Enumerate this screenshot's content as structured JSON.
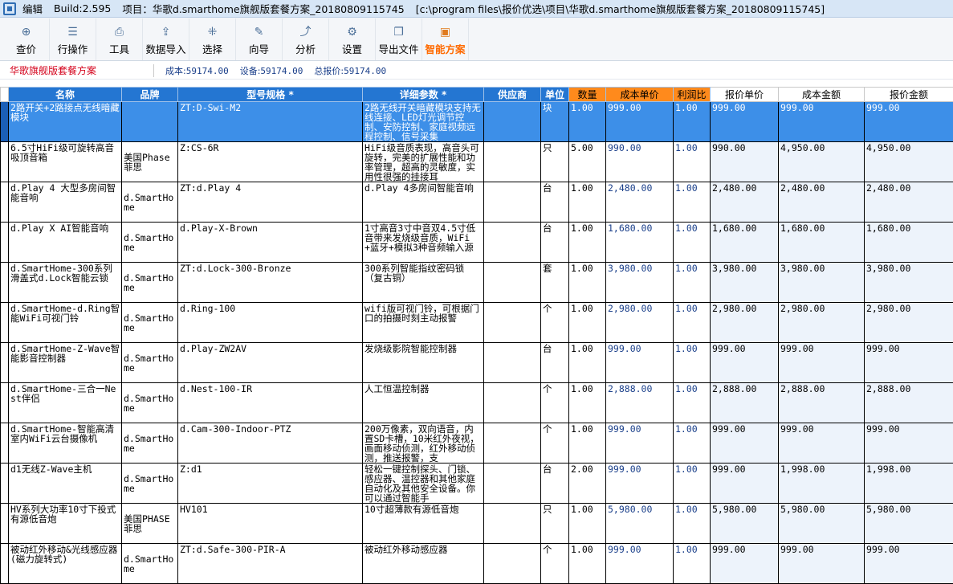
{
  "titlebar": {
    "menu_edit": "编辑",
    "build": "Build:2.595",
    "project": "项目：华歌d.smarthome旗舰版套餐方案_20180809115745",
    "path": "[c:\\program files\\报价优选\\项目\\华歌d.smarthome旗舰版套餐方案_20180809115745]"
  },
  "toolbar": {
    "items": [
      {
        "label": "查价",
        "icon": "⊕"
      },
      {
        "label": "行操作",
        "icon": "☰"
      },
      {
        "label": "工具",
        "icon": "⎙"
      },
      {
        "label": "数据导入",
        "icon": "⇪"
      },
      {
        "label": "选择",
        "icon": "⁜"
      },
      {
        "label": "向导",
        "icon": "✎"
      },
      {
        "label": "分析",
        "icon": "⤴"
      },
      {
        "label": "设置",
        "icon": "⚙"
      },
      {
        "label": "导出文件",
        "icon": "❐"
      },
      {
        "label": "智能方案",
        "icon": "▣"
      }
    ]
  },
  "info": {
    "scheme_name": "华歌旗舰版套餐方案",
    "cost_label": "成本:",
    "cost_value": "59174.00",
    "device_label": "设备:",
    "device_value": "59174.00",
    "total_label": "总报价:",
    "total_value": "59174.00"
  },
  "table": {
    "headers": [
      "名称",
      "品牌",
      "型号规格 *",
      "详细参数 *",
      "供应商",
      "单位",
      "数量",
      "成本单价",
      "利润比",
      "报价单价",
      "成本金额",
      "报价金额"
    ],
    "rows": [
      [
        "2路开关+2路接点无线暗藏模块",
        "",
        "ZT:D-Swi-M2",
        "2路无线开关暗藏模块支持无线连接、LED灯光调节控制、安防控制、家庭视频远程控制、信号采集",
        "",
        "块",
        "1.00",
        "999.00",
        "1.00",
        "999.00",
        "999.00",
        "999.00"
      ],
      [
        "6.5寸HiFi级可旋转高音吸顶音箱",
        "美国Phase菲思",
        "Z:CS-6R",
        "HiFi级音质表现，高音头可旋转，完美的扩展性能和功率管理，超高的灵敏度，实用性很强的挂接耳",
        "",
        "只",
        "5.00",
        "990.00",
        "1.00",
        "990.00",
        "4,950.00",
        "4,950.00"
      ],
      [
        "d.Play 4 大型多房间智能音响",
        "d.SmartHome",
        "ZT:d.Play 4",
        "d.Play 4多房间智能音响",
        "",
        "台",
        "1.00",
        "2,480.00",
        "1.00",
        "2,480.00",
        "2,480.00",
        "2,480.00"
      ],
      [
        "d.Play X AI智能音响",
        "d.SmartHome",
        "d.Play-X-Brown",
        "1寸高音3寸中音双4.5寸低音带来发烧级音质，WiFi+蓝牙+模拟3种音频输入源",
        "",
        "台",
        "1.00",
        "1,680.00",
        "1.00",
        "1,680.00",
        "1,680.00",
        "1,680.00"
      ],
      [
        "d.SmartHome-300系列滑盖式d.Lock智能云锁",
        "d.SmartHome",
        "ZT:d.Lock-300-Bronze",
        "300系列智能指纹密码锁（复古铜）",
        "",
        "套",
        "1.00",
        "3,980.00",
        "1.00",
        "3,980.00",
        "3,980.00",
        "3,980.00"
      ],
      [
        "d.SmartHome-d.Ring智能WiFi可视门铃",
        "d.SmartHome",
        "d.Ring-100",
        "wifi版可视门铃，可根据门口的拍摄时刻主动报警",
        "",
        "个",
        "1.00",
        "2,980.00",
        "1.00",
        "2,980.00",
        "2,980.00",
        "2,980.00"
      ],
      [
        "d.SmartHome-Z-Wave智能影音控制器",
        "d.SmartHome",
        "d.Play-ZW2AV",
        "发烧级影院智能控制器",
        "",
        "台",
        "1.00",
        "999.00",
        "1.00",
        "999.00",
        "999.00",
        "999.00"
      ],
      [
        "d.SmartHome-三合一Nest伴侣",
        "d.SmartHome",
        "d.Nest-100-IR",
        "人工恒温控制器",
        "",
        "个",
        "1.00",
        "2,888.00",
        "1.00",
        "2,888.00",
        "2,888.00",
        "2,888.00"
      ],
      [
        "d.SmartHome-智能高清室内WiFi云台摄像机",
        "d.SmartHome",
        "d.Cam-300-Indoor-PTZ",
        "200万像素，双向语音，内置SD卡槽，10米红外夜视，画面移动侦测，红外移动侦测，推送报警，支",
        "",
        "个",
        "1.00",
        "999.00",
        "1.00",
        "999.00",
        "999.00",
        "999.00"
      ],
      [
        "d1无线Z-Wave主机",
        "d.SmartHome",
        "Z:d1",
        "轻松一键控制探头、门锁、感应器、温控器和其他家庭自动化及其他安全设备。你可以通过智能手",
        "",
        "台",
        "2.00",
        "999.00",
        "1.00",
        "999.00",
        "1,998.00",
        "1,998.00"
      ],
      [
        "HV系列大功率10寸下投式有源低音炮",
        "美国PHASE菲思",
        "HV101",
        "10寸超薄款有源低音炮",
        "",
        "只",
        "1.00",
        "5,980.00",
        "1.00",
        "5,980.00",
        "5,980.00",
        "5,980.00"
      ],
      [
        "被动红外移动&光线感应器(磁力旋转式)",
        "d.SmartHome",
        "ZT:d.Safe-300-PIR-A",
        "被动红外移动感应器",
        "",
        "个",
        "1.00",
        "999.00",
        "1.00",
        "999.00",
        "999.00",
        "999.00"
      ]
    ]
  }
}
